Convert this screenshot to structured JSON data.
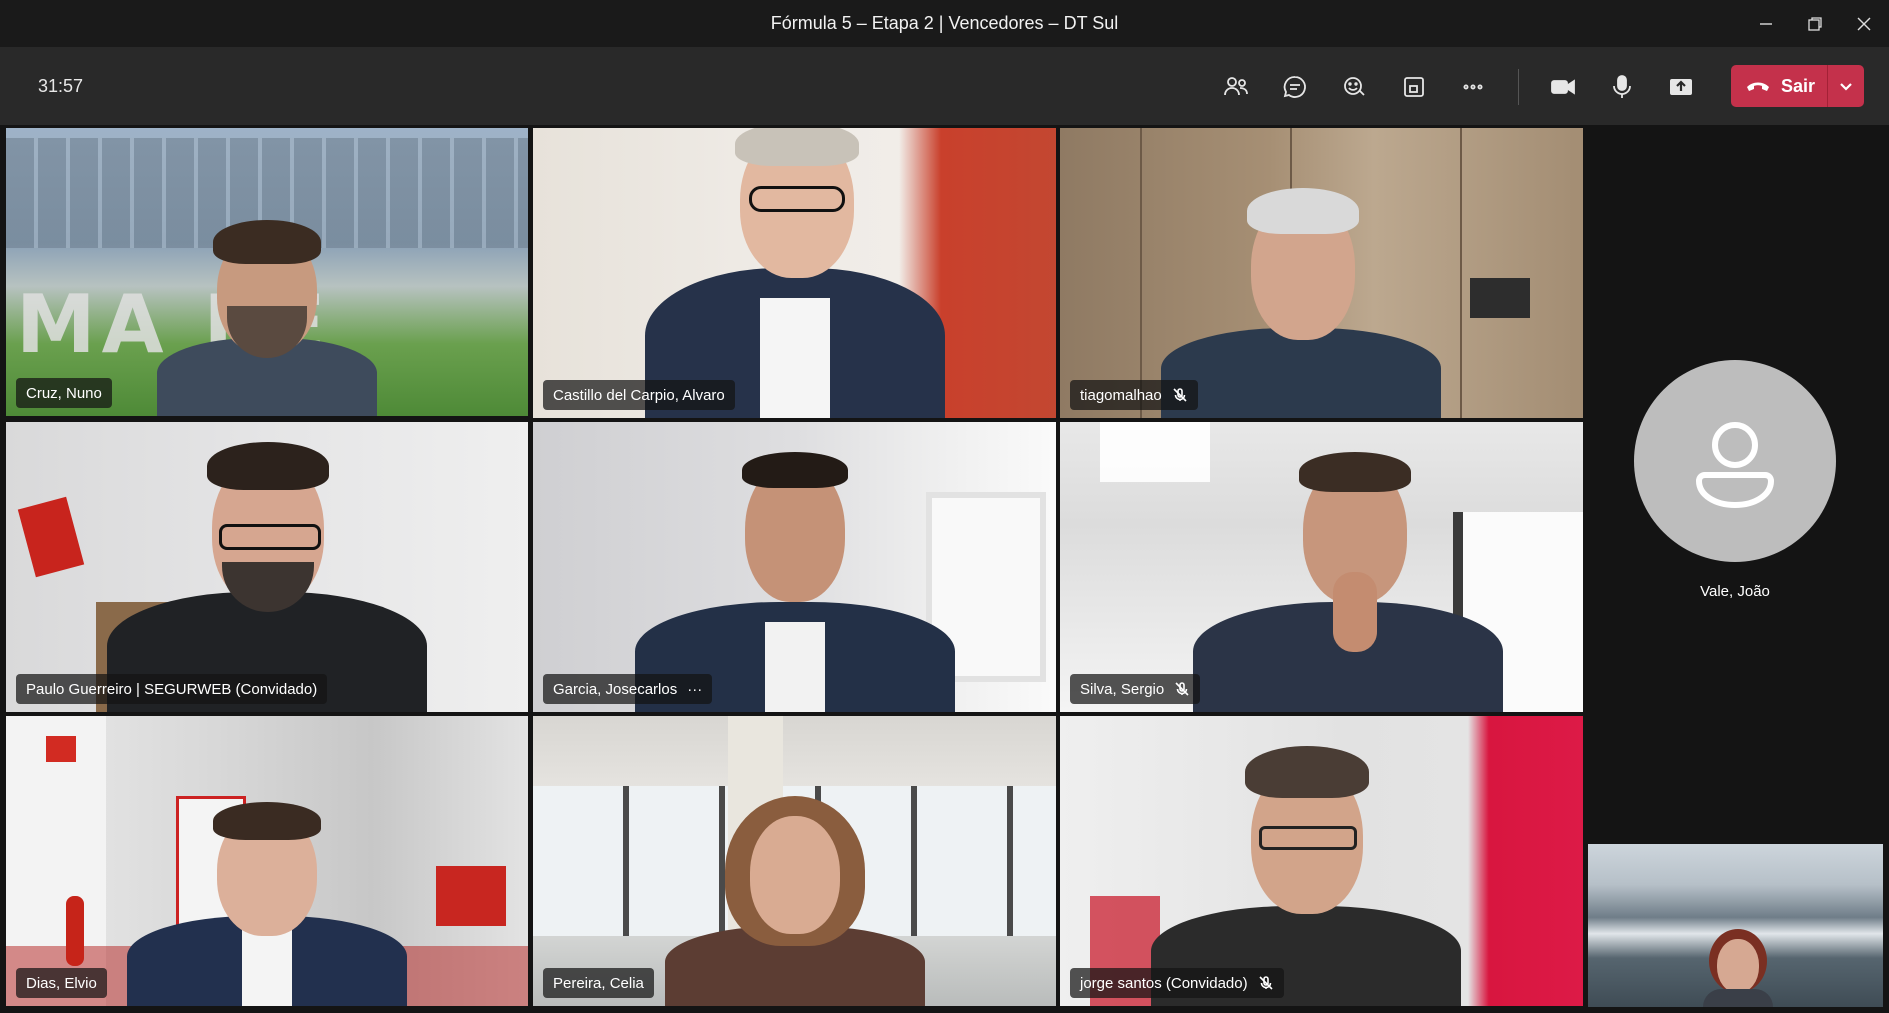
{
  "window": {
    "title": "Fórmula 5 – Etapa 2 | Vencedores – DT Sul",
    "controls": [
      "minimize-icon",
      "restore-icon",
      "close-icon"
    ]
  },
  "toolbar": {
    "timer": "31:57",
    "icons": [
      "people-icon",
      "chat-icon",
      "react-icon",
      "rooms-icon",
      "more-icon",
      "camera-icon",
      "mic-icon",
      "share-icon"
    ],
    "leave_label": "Sair",
    "leave_color": "#c4314b"
  },
  "participants": [
    {
      "name": "Cruz, Nuno",
      "muted": false,
      "active_speaker": true
    },
    {
      "name": "Castillo del Carpio, Alvaro",
      "muted": false
    },
    {
      "name": "tiagomalhao",
      "muted": true
    },
    {
      "name": "Paulo Guerreiro | SEGURWEB (Convidado)",
      "muted": false
    },
    {
      "name": "Garcia, Josecarlos",
      "more": "···"
    },
    {
      "name": "Silva, Sergio",
      "muted": true
    },
    {
      "name": "Dias, Elvio",
      "muted": false
    },
    {
      "name": "Pereira, Celia",
      "muted": false
    },
    {
      "name": "jorge santos (Convidado)",
      "muted": true
    }
  ],
  "side_panel": {
    "avatar_name": "Vale, João"
  },
  "colors": {
    "active_speaker_outline": "#7f85f5",
    "background": "#1f1f1f"
  }
}
